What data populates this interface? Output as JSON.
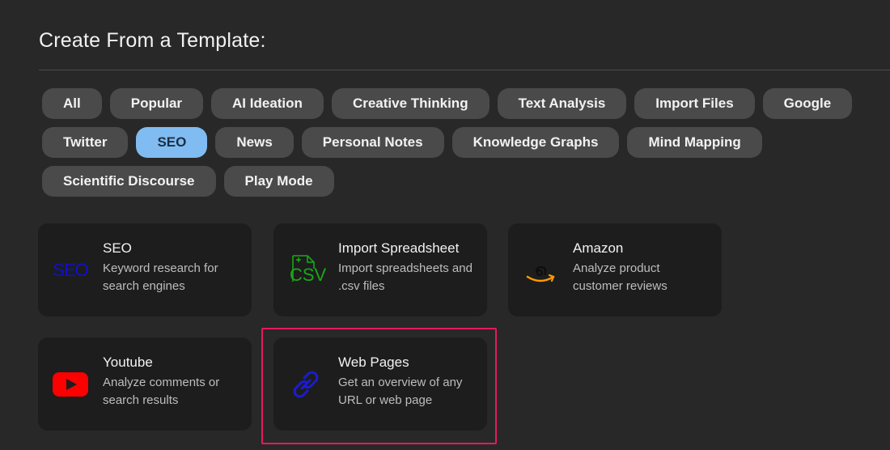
{
  "header": {
    "title": "Create From a Template:"
  },
  "filters": {
    "row1": [
      "All",
      "Popular",
      "AI Ideation",
      "Creative Thinking",
      "Text Analysis",
      "Import Files",
      "Google"
    ],
    "row2": [
      "Twitter",
      "SEO",
      "News",
      "Personal Notes",
      "Knowledge Graphs",
      "Mind Mapping"
    ],
    "row3": [
      "Scientific Discourse",
      "Play Mode"
    ],
    "active": "SEO"
  },
  "templates": [
    {
      "title": "SEO",
      "desc": "Keyword research for search engines",
      "icon": "seo-icon",
      "icon_text": "SEO",
      "icon_color": "#1010d0"
    },
    {
      "title": "Import Spreadsheet",
      "desc": "Import spreadsheets and .csv files",
      "icon": "csv-file-icon",
      "icon_text": "CSV",
      "icon_color": "#18a818"
    },
    {
      "title": "Amazon",
      "desc": "Analyze product customer reviews",
      "icon": "amazon-icon",
      "icon_color": "#ff9900"
    },
    {
      "title": "Youtube",
      "desc": "Analyze comments or search results",
      "icon": "youtube-icon",
      "icon_color": "#ff0000"
    },
    {
      "title": "Web Pages",
      "desc": "Get an overview of any URL or web page",
      "icon": "link-icon",
      "icon_color": "#1c1ccf"
    }
  ],
  "colors": {
    "background": "#282828",
    "chip": "#4a4a4a",
    "chip_active": "#80bcf1",
    "card": "#1d1d1d",
    "highlight": "#e8185f"
  }
}
